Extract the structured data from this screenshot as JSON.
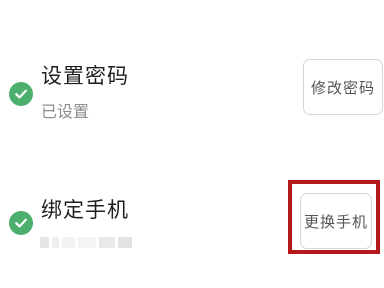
{
  "password": {
    "title": "设置密码",
    "status": "已设置",
    "button_label": "修改密码",
    "icon": "check-circle-icon"
  },
  "phone": {
    "title": "绑定手机",
    "button_label": "更换手机",
    "icon": "check-circle-icon"
  },
  "colors": {
    "check_green": "#4caf6e",
    "highlight_red": "#b4181a"
  }
}
